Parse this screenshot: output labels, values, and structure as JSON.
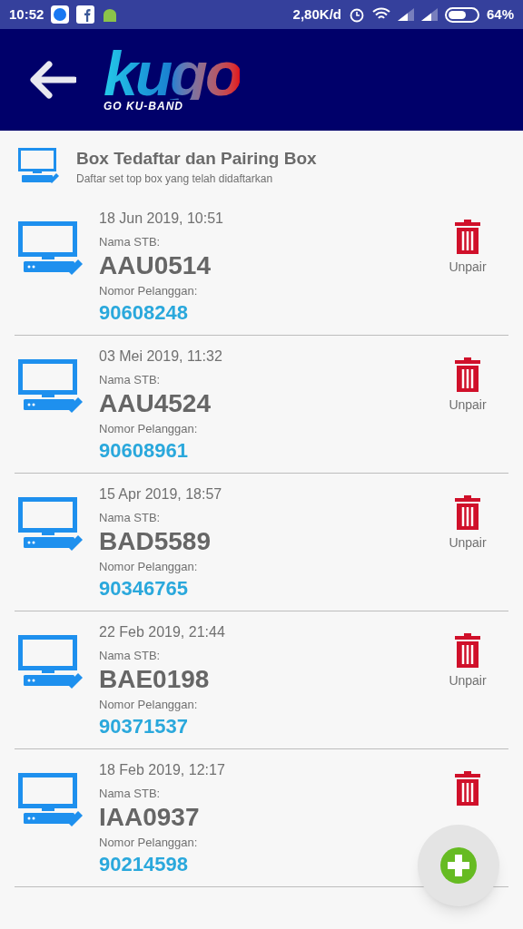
{
  "status_bar": {
    "time": "10:52",
    "speed": "2,80K/d",
    "battery": "64%"
  },
  "header": {
    "logo_text": "kugo",
    "logo_tagline": "GO KU-BAND"
  },
  "section": {
    "title": "Box Tedaftar dan Pairing Box",
    "subtitle": "Daftar set top box yang telah didaftarkan"
  },
  "boxes": [
    {
      "date": "18 Jun 2019, 10:51",
      "name_label": "Nama STB:",
      "name": "AAU0514",
      "customer_label": "Nomor Pelanggan:",
      "customer": "90608248",
      "action": "Unpair"
    },
    {
      "date": "03 Mei 2019, 11:32",
      "name_label": "Nama STB:",
      "name": "AAU4524",
      "customer_label": "Nomor Pelanggan:",
      "customer": "90608961",
      "action": "Unpair"
    },
    {
      "date": "15 Apr 2019, 18:57",
      "name_label": "Nama STB:",
      "name": "BAD5589",
      "customer_label": "Nomor Pelanggan:",
      "customer": "90346765",
      "action": "Unpair"
    },
    {
      "date": "22 Feb 2019, 21:44",
      "name_label": "Nama STB:",
      "name": "BAE0198",
      "customer_label": "Nomor Pelanggan:",
      "customer": "90371537",
      "action": "Unpair"
    },
    {
      "date": "18 Feb 2019, 12:17",
      "name_label": "Nama STB:",
      "name": "IAA0937",
      "customer_label": "Nomor Pelanggan:",
      "customer": "90214598"
    }
  ]
}
